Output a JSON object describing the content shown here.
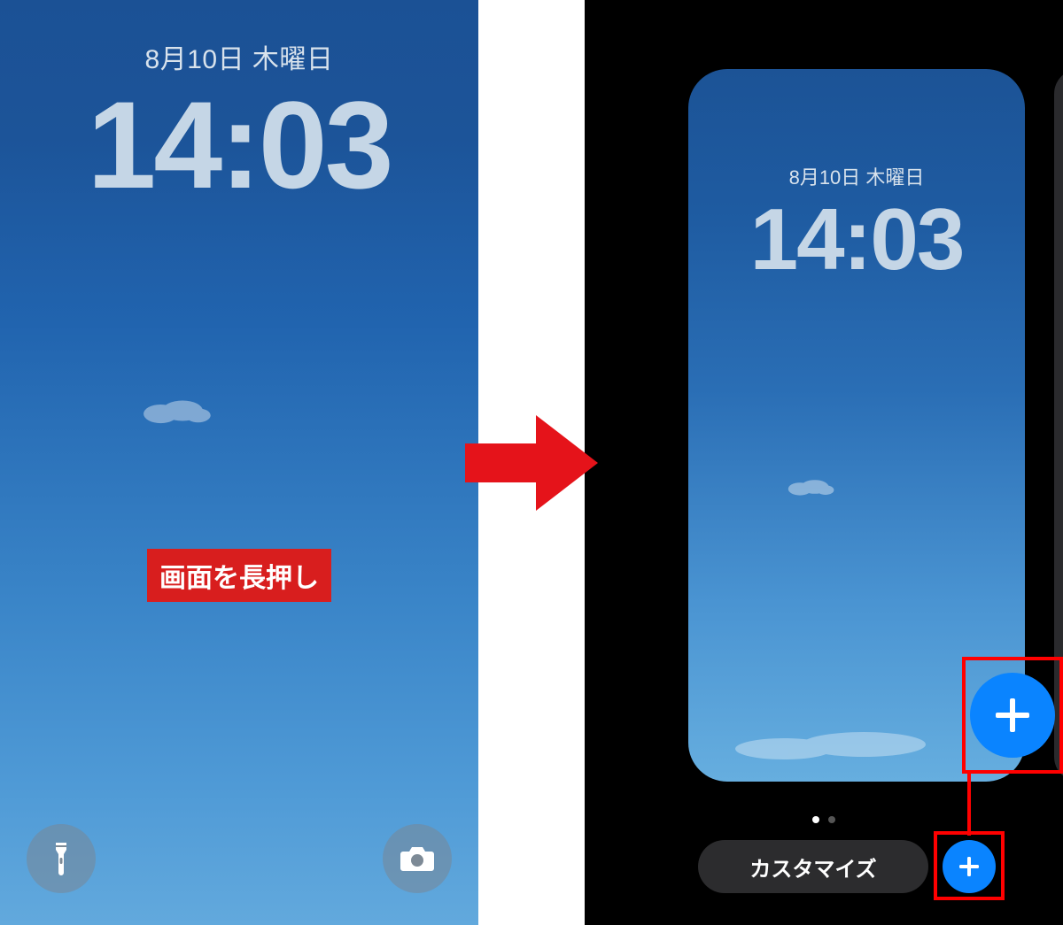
{
  "left": {
    "date": "8月10日 木曜日",
    "time": "14:03",
    "callout": "画面を長押し"
  },
  "right": {
    "preview": {
      "date": "8月10日 木曜日",
      "time": "14:03"
    },
    "customize_label": "カスタマイズ"
  }
}
